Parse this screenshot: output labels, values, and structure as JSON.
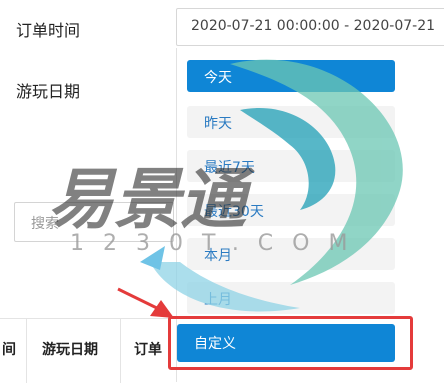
{
  "filters": {
    "order_time_label": "订单时间",
    "order_time_value": "2020-07-21 00:00:00 - 2020-07-21",
    "play_date_label": "游玩日期"
  },
  "date_presets": [
    {
      "label": "今天",
      "active": true
    },
    {
      "label": "昨天",
      "active": false
    },
    {
      "label": "最近7天",
      "active": false
    },
    {
      "label": "最近30天",
      "active": false
    },
    {
      "label": "本月",
      "active": false
    },
    {
      "label": "上月",
      "active": false
    },
    {
      "label": "自定义",
      "active": true
    }
  ],
  "search": {
    "placeholder": "搜索"
  },
  "table": {
    "headers": [
      "间",
      "游玩日期",
      "订单"
    ]
  },
  "watermark": {
    "brand": "易景通",
    "url_text": "1230T.COM"
  },
  "colors": {
    "accent": "#0f86d6",
    "annotation": "#e43b3b",
    "link": "#2b7bc2"
  }
}
